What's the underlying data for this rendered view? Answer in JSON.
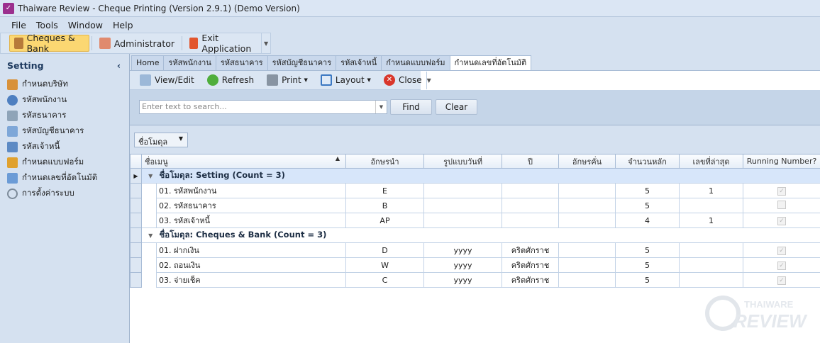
{
  "window": {
    "title": "Thaiware Review - Cheque Printing (Version 2.9.1) (Demo Version)"
  },
  "menu": [
    "File",
    "Tools",
    "Window",
    "Help"
  ],
  "main_toolbar": {
    "cheques_bank": "Cheques & Bank",
    "administrator": "Administrator",
    "exit": "Exit Application"
  },
  "sidebar": {
    "title": "Setting",
    "collapse": "‹",
    "items": [
      {
        "label": "กำหนดบริษัท",
        "icon": "home-icon"
      },
      {
        "label": "รหัสพนักงาน",
        "icon": "user-icon"
      },
      {
        "label": "รหัสธนาคาร",
        "icon": "building-icon"
      },
      {
        "label": "รหัสบัญชีธนาคาร",
        "icon": "book-icon"
      },
      {
        "label": "รหัสเจ้าหนี้",
        "icon": "id-card-icon"
      },
      {
        "label": "กำหนดแบบฟอร์ม",
        "icon": "ruler-icon"
      },
      {
        "label": "กำหนดเลขที่อัตโนมัติ",
        "icon": "document-gear-icon"
      },
      {
        "label": "การตั้งค่าระบบ",
        "icon": "gear-icon"
      }
    ]
  },
  "tabs": [
    "Home",
    "รหัสพนักงาน",
    "รหัสธนาคาร",
    "รหัสบัญชีธนาคาร",
    "รหัสเจ้าหนี้",
    "กำหนดแบบฟอร์ม",
    "กำหนดเลขที่อัตโนมัติ"
  ],
  "toolbar": {
    "view_edit": "View/Edit",
    "refresh": "Refresh",
    "print": "Print",
    "layout": "Layout",
    "close": "Close"
  },
  "search": {
    "placeholder": "Enter text to search...",
    "find": "Find",
    "clear": "Clear"
  },
  "group_by": "ชื่อโมดุล",
  "grid": {
    "columns": [
      "ชื่อเมนู",
      "อักษรนำ",
      "รูปแบบวันที่",
      "ปี",
      "อักษรคั่น",
      "จำนวนหลัก",
      "เลขที่ล่าสุด",
      "Running Number?"
    ],
    "groups": [
      {
        "label": "ชื่อโมดุล: Setting (Count = 3)",
        "rows": [
          {
            "name": "01. รหัสพนักงาน",
            "prefix": "E",
            "date_format": "",
            "year": "",
            "separator": "",
            "digits": "5",
            "last_no": "1",
            "running": true
          },
          {
            "name": "02. รหัสธนาคาร",
            "prefix": "B",
            "date_format": "",
            "year": "",
            "separator": "",
            "digits": "5",
            "last_no": "",
            "running": false
          },
          {
            "name": "03. รหัสเจ้าหนี้",
            "prefix": "AP",
            "date_format": "",
            "year": "",
            "separator": "",
            "digits": "4",
            "last_no": "1",
            "running": true
          }
        ]
      },
      {
        "label": "ชื่อโมดุล: Cheques & Bank (Count = 3)",
        "rows": [
          {
            "name": "01. ฝากเงิน",
            "prefix": "D",
            "date_format": "yyyy",
            "year": "คริตศักราช",
            "separator": "",
            "digits": "5",
            "last_no": "",
            "running": true
          },
          {
            "name": "02. ถอนเงิน",
            "prefix": "W",
            "date_format": "yyyy",
            "year": "คริตศักราช",
            "separator": "",
            "digits": "5",
            "last_no": "",
            "running": true
          },
          {
            "name": "03. จ่ายเช็ค",
            "prefix": "C",
            "date_format": "yyyy",
            "year": "คริตศักราช",
            "separator": "",
            "digits": "5",
            "last_no": "",
            "running": true
          }
        ]
      }
    ]
  },
  "watermark": "THAIWARE REVIEW"
}
